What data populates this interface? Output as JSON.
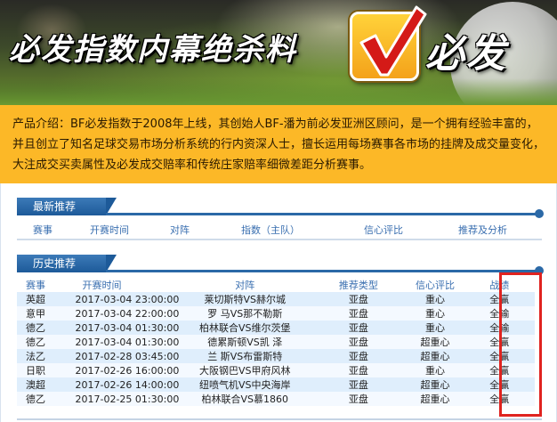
{
  "banner": {
    "title": "必发指数内幕绝杀料",
    "title2": "必发"
  },
  "intro": {
    "text": "产品介绍：BF必发指数于2008年上线，其创始人BF-潘为前必发亚洲区顾问，是一个拥有经验丰富的，并且创立了知名足球交易市场分析系统的行内资深人士，擅长运用每场赛事各市场的挂牌及成交量变化，大注成交买卖属性及必发成交赔率和传统庄家赔率细微差距分析赛事。"
  },
  "latest": {
    "tab": "最新推荐",
    "columns": [
      "赛事",
      "开赛时间",
      "对阵",
      "指数（主队）",
      "信心评比",
      "推荐及分析"
    ]
  },
  "history": {
    "tab": "历史推荐",
    "columns": [
      "赛事",
      "开赛时间",
      "对阵",
      "推荐类型",
      "信心评比",
      "战绩"
    ],
    "rows": [
      {
        "league": "英超",
        "time": "2017-03-04 23:00:00",
        "match": "莱切斯特VS赫尔城",
        "type": "亚盘",
        "confidence": "重心",
        "result": "全赢"
      },
      {
        "league": "意甲",
        "time": "2017-03-04 22:00:00",
        "match": "罗 马VS那不勒斯",
        "type": "亚盘",
        "confidence": "重心",
        "result": "全输"
      },
      {
        "league": "德乙",
        "time": "2017-03-04 01:30:00",
        "match": "柏林联合VS维尔茨堡",
        "type": "亚盘",
        "confidence": "重心",
        "result": "全输"
      },
      {
        "league": "德乙",
        "time": "2017-03-04 01:30:00",
        "match": "德累斯顿VS凯 泽",
        "type": "亚盘",
        "confidence": "超重心",
        "result": "全赢"
      },
      {
        "league": "法乙",
        "time": "2017-02-28 03:45:00",
        "match": "兰 斯VS布雷斯特",
        "type": "亚盘",
        "confidence": "超重心",
        "result": "全赢"
      },
      {
        "league": "日职",
        "time": "2017-02-26 16:00:00",
        "match": "大阪钢巴VS甲府风林",
        "type": "亚盘",
        "confidence": "重心",
        "result": "全赢"
      },
      {
        "league": "澳超",
        "time": "2017-02-26 14:00:00",
        "match": "纽喷气机VS中央海岸",
        "type": "亚盘",
        "confidence": "超重心",
        "result": "全赢"
      },
      {
        "league": "德乙",
        "time": "2017-02-25 01:30:00",
        "match": "柏林联合VS慕1860",
        "type": "亚盘",
        "confidence": "超重心",
        "result": "全赢"
      }
    ]
  },
  "colors": {
    "intro_bg": "#fcb827",
    "tab_blue": "#1d5a99",
    "row_blue": "#dfeefc",
    "highlight_red": "#e0231f",
    "header_text": "#3a6fb0"
  },
  "icons": [
    "check-mark-icon",
    "football-icon"
  ]
}
